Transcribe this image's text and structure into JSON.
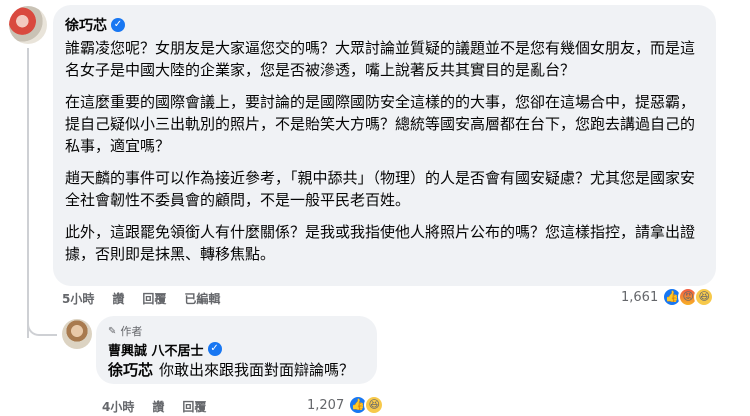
{
  "comment": {
    "author": "徐巧芯",
    "paragraphs": [
      "誰霸凌您呢？女朋友是大家逼您交的嗎？大眾討論並質疑的議題並不是您有幾個女朋友，而是這名女子是中國大陸的企業家，您是否被滲透，嘴上說著反共其實目的是亂台？",
      "在這麼重要的國際會議上，要討論的是國際國防安全這樣的的大事，您卻在這場合中，提惡霸，提自己疑似小三出軌別的照片，不是貽笑大方嗎？總統等國安高層都在台下，您跑去講過自己的私事，適宜嗎？",
      "趙天麟的事件可以作為接近參考，「親中舔共」（物理）的人是否會有國安疑慮？尤其您是國家安全社會韌性不委員會的顧問，不是一般平民老百姓。",
      "此外，這跟罷免領銜人有什麼關係？是我或我指使他人將照片公布的嗎？您這樣指控，請拿出證據，否則即是抹黑、轉移焦點。"
    ],
    "time": "5小時",
    "actions": [
      "讚",
      "回覆",
      "已編輯"
    ],
    "reaction_count": "1,661"
  },
  "reply": {
    "author_tag": "作者",
    "author": "曹興誠 八不居士",
    "mention": "徐巧芯",
    "text": "你敢出來跟我面對面辯論嗎？",
    "time": "4小時",
    "actions": [
      "讚",
      "回覆"
    ],
    "reaction_count": "1,207"
  },
  "icons": {
    "verified": "verified-badge-icon",
    "like": "like-reaction-icon",
    "angry": "angry-reaction-icon",
    "haha": "haha-reaction-icon",
    "author_tag": "pen-icon"
  },
  "colors": {
    "accent": "#1877f2",
    "bubble": "#f0f2f5",
    "meta": "#65676b"
  }
}
